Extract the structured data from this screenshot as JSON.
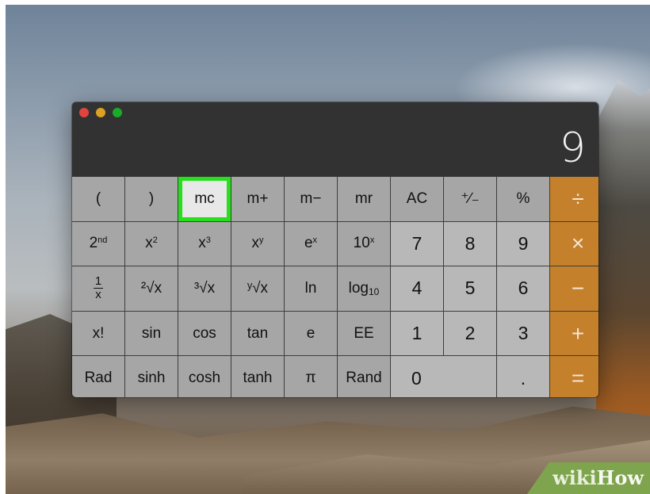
{
  "window": {
    "display_value": "9",
    "highlighted_key": "mc"
  },
  "keys": {
    "paren_open": "(",
    "paren_close": ")",
    "mc": "mc",
    "m_plus": "m+",
    "m_minus": "m−",
    "mr": "mr",
    "ac": "AC",
    "plus_minus": "⁺∕₋",
    "percent": "%",
    "divide": "÷",
    "second": "2",
    "second_sup": "nd",
    "x_sq_base": "x",
    "x_sq_sup": "2",
    "x_cube_base": "x",
    "x_cube_sup": "3",
    "x_y_base": "x",
    "x_y_sup": "y",
    "e_x_base": "e",
    "e_x_sup": "x",
    "ten_x_base": "10",
    "ten_x_sup": "x",
    "d7": "7",
    "d8": "8",
    "d9": "9",
    "multiply": "×",
    "recip_num": "1",
    "recip_den": "x",
    "sqrt2": "²√x",
    "sqrt3": "³√x",
    "sqrty": "ʸ√x",
    "ln": "ln",
    "log_base": "log",
    "log_sub": "10",
    "d4": "4",
    "d5": "5",
    "d6": "6",
    "minus": "−",
    "factorial": "x!",
    "sin": "sin",
    "cos": "cos",
    "tan": "tan",
    "e": "e",
    "ee": "EE",
    "d1": "1",
    "d2": "2",
    "d3": "3",
    "plus": "+",
    "rad": "Rad",
    "sinh": "sinh",
    "cosh": "cosh",
    "tanh": "tanh",
    "pi": "π",
    "rand": "Rand",
    "d0": "0",
    "decimal": ".",
    "equals": "="
  },
  "watermark": {
    "part1": "wiki",
    "part2": "How"
  },
  "colors": {
    "operator": "#c4802a",
    "highlight_outline": "#27e01b",
    "key": "#a6a6a6",
    "digit_key": "#b8b8b8",
    "display_bg": "#323232"
  }
}
